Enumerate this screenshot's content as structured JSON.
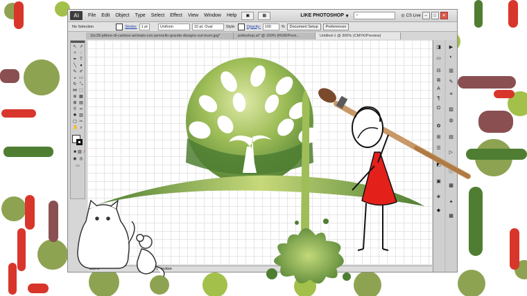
{
  "app": {
    "logo": "Ai",
    "menus": [
      "File",
      "Edit",
      "Object",
      "Type",
      "Select",
      "Effect",
      "View",
      "Window",
      "Help"
    ],
    "workspace": "LIKE PHOTOSHOP",
    "search_placeholder": "",
    "cs_live": "CS Live",
    "colors": {
      "accent_green": "#8bb24a",
      "dark_green": "#4f7e33",
      "paint_red": "#e4201b"
    }
  },
  "control_bar": {
    "selection": "No Selection",
    "stroke_label": "Stroke:",
    "stroke_value": "1 pt",
    "profile": "Uniform",
    "brush": "10 pt. Oval",
    "style_label": "Style:",
    "opacity_label": "Opacity:",
    "opacity_value": "100",
    "percent": "%",
    "doc_setup": "Document Setup",
    "preferences": "Preferences"
  },
  "tabs": [
    {
      "label": "1bc39-pittore-di-cartone-animato-con-pennello-grande-disegno-sul-muro.jpg*"
    },
    {
      "label": "pottoshop.ai* @ 150% (RGB/Previ..."
    },
    {
      "label": "Untitled-1 @ 300% (CMYK/Preview)"
    }
  ],
  "status": {
    "zoom": "300%",
    "selection": "Selection"
  }
}
